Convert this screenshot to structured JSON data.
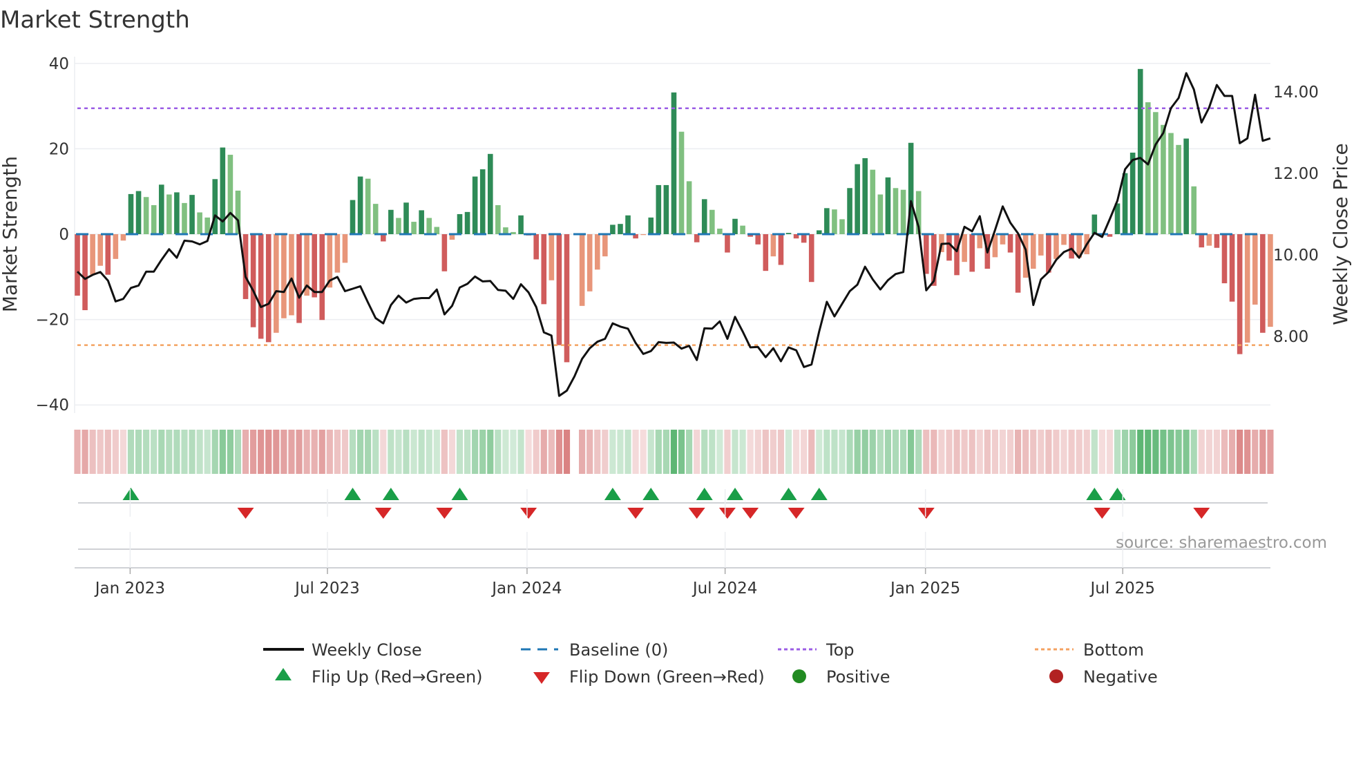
{
  "chart_data": {
    "type": "bar",
    "title": "Market Strength",
    "ylabel": "Market Strength",
    "y2label": "Weekly Close Price",
    "ylim": [
      -40,
      40
    ],
    "yticks": [
      {
        "v": 40,
        "label": "40"
      },
      {
        "v": 20,
        "label": "20"
      },
      {
        "v": 0,
        "label": "0"
      },
      {
        "v": -20,
        "label": "−20"
      },
      {
        "v": -40,
        "label": "−40"
      }
    ],
    "y2ticks": [
      {
        "v": 14,
        "label": "14.00"
      },
      {
        "v": 12,
        "label": "12.00"
      },
      {
        "v": 10,
        "label": "10.00"
      },
      {
        "v": 8,
        "label": "8.00"
      }
    ],
    "xticks": [
      {
        "x": 6.9,
        "label": "Jan 2023"
      },
      {
        "x": 32.7,
        "label": "Jul 2023"
      },
      {
        "x": 58.8,
        "label": "Jan 2024"
      },
      {
        "x": 84.7,
        "label": "Jul 2024"
      },
      {
        "x": 110.9,
        "label": "Jan 2025"
      },
      {
        "x": 136.7,
        "label": "Jul 2025"
      }
    ],
    "top_level": 29.5,
    "bottom_level": -26,
    "baseline": 0,
    "strength": [
      -14.4,
      -17.8,
      -9.5,
      -7.4,
      -9.5,
      -5.8,
      -1.5,
      9.4,
      10.1,
      8.7,
      6.8,
      11.6,
      9.3,
      9.8,
      7.3,
      9.2,
      5.1,
      3.9,
      12.9,
      20.3,
      18.6,
      10.2,
      -15.2,
      -21.8,
      -24.5,
      -25.3,
      -23.1,
      -19.7,
      -19.0,
      -20.8,
      -14.4,
      -14.8,
      -20.1,
      -12.5,
      -9.0,
      -6.7,
      8.0,
      13.5,
      13.0,
      7.1,
      -1.7,
      5.7,
      3.8,
      7.4,
      2.9,
      5.6,
      3.8,
      1.7,
      -8.7,
      -1.3,
      4.7,
      5.2,
      13.5,
      15.2,
      18.8,
      6.8,
      1.6,
      0.5,
      4.4,
      -0.3,
      -5.9,
      -16.4,
      -10.8,
      -26.0,
      -30.0,
      null,
      -16.8,
      -13.4,
      -8.3,
      -5.2,
      2.2,
      2.4,
      4.4,
      -1.0,
      -0.2,
      3.9,
      11.5,
      11.5,
      33.2,
      24.0,
      12.4,
      -1.9,
      8.2,
      5.7,
      1.3,
      -4.3,
      3.6,
      2.0,
      -0.6,
      -2.4,
      -8.6,
      -5.2,
      -7.2,
      0.3,
      -1.0,
      -2.0,
      -11.2,
      0.9,
      6.1,
      5.8,
      3.5,
      10.8,
      16.4,
      17.8,
      15.1,
      9.3,
      13.3,
      10.8,
      10.4,
      21.4,
      10.1,
      -9.3,
      -12.1,
      -4.2,
      -6.2,
      -9.6,
      -6.5,
      -8.8,
      -3.3,
      -8.1,
      -5.4,
      -2.4,
      -4.3,
      -13.7,
      -10.2,
      -8.1,
      -5.0,
      -9.0,
      -5.8,
      -2.5,
      -5.7,
      -5.5,
      -4.7,
      4.6,
      -0.2,
      -0.6,
      7.2,
      14.3,
      19.1,
      38.7,
      30.9,
      28.6,
      25.6,
      23.7,
      20.9,
      22.4,
      11.2,
      -3.1,
      -2.7,
      -3.2,
      -11.5,
      -15.8,
      -28.1,
      -25.4,
      -16.5,
      -23.1,
      -21.7
    ],
    "weekly_close": [
      9.59,
      9.41,
      9.51,
      9.58,
      9.37,
      8.86,
      8.92,
      9.19,
      9.25,
      9.59,
      9.59,
      9.88,
      10.14,
      9.93,
      10.35,
      10.33,
      10.26,
      10.34,
      10.97,
      10.82,
      11.03,
      10.85,
      9.46,
      9.12,
      8.72,
      8.8,
      9.11,
      9.09,
      9.42,
      8.95,
      9.25,
      9.09,
      9.09,
      9.37,
      9.46,
      9.11,
      9.17,
      9.23,
      8.83,
      8.45,
      8.32,
      8.77,
      9.0,
      8.83,
      8.92,
      8.94,
      8.94,
      9.15,
      8.54,
      8.75,
      9.2,
      9.29,
      9.47,
      9.35,
      9.36,
      9.14,
      9.12,
      8.92,
      9.28,
      9.08,
      8.72,
      8.1,
      8.02,
      6.54,
      6.67,
      7.02,
      7.45,
      7.71,
      7.87,
      7.94,
      8.32,
      8.24,
      8.19,
      7.84,
      7.57,
      7.64,
      7.86,
      7.84,
      7.85,
      7.7,
      7.77,
      7.42,
      8.2,
      8.19,
      8.37,
      7.94,
      8.48,
      8.12,
      7.73,
      7.74,
      7.49,
      7.71,
      7.39,
      7.73,
      7.66,
      7.25,
      7.31,
      8.12,
      8.85,
      8.49,
      8.8,
      9.11,
      9.27,
      9.71,
      9.4,
      9.15,
      9.38,
      9.53,
      9.58,
      11.32,
      10.69,
      9.13,
      9.36,
      10.27,
      10.28,
      10.09,
      10.69,
      10.58,
      10.95,
      10.06,
      10.61,
      11.19,
      10.79,
      10.53,
      10.13,
      8.77,
      9.4,
      9.58,
      9.88,
      10.07,
      10.15,
      9.93,
      10.26,
      10.54,
      10.44,
      10.88,
      11.33,
      12.1,
      12.33,
      12.38,
      12.22,
      12.71,
      12.99,
      13.6,
      13.85,
      14.46,
      14.06,
      13.25,
      13.62,
      14.17,
      13.9,
      13.9,
      12.74,
      12.86,
      13.93,
      12.8,
      12.86
    ],
    "legend": {
      "weekly_close": "Weekly Close",
      "baseline": "Baseline (0)",
      "top": "Top",
      "bottom": "Bottom",
      "flip_up": "Flip Up (Red→Green)",
      "flip_down": "Flip Down (Green→Red)",
      "positive": "Positive",
      "negative": "Negative"
    },
    "legend_placement": "bottom",
    "grid": true,
    "source": "source: sharemaestro.com"
  },
  "colors": {
    "pos_strong": "#2e8b57",
    "pos_weak": "#80c080",
    "neg_strong": "#d05c5c",
    "neg_weak": "#e8967a",
    "line": "#111111",
    "baseline": "#1f77b4",
    "top": "#9b5de5",
    "bottom": "#f4a261",
    "flip_up": "#1a9e48",
    "flip_down": "#d62728",
    "positive": "#228b22",
    "negative": "#b22222"
  }
}
